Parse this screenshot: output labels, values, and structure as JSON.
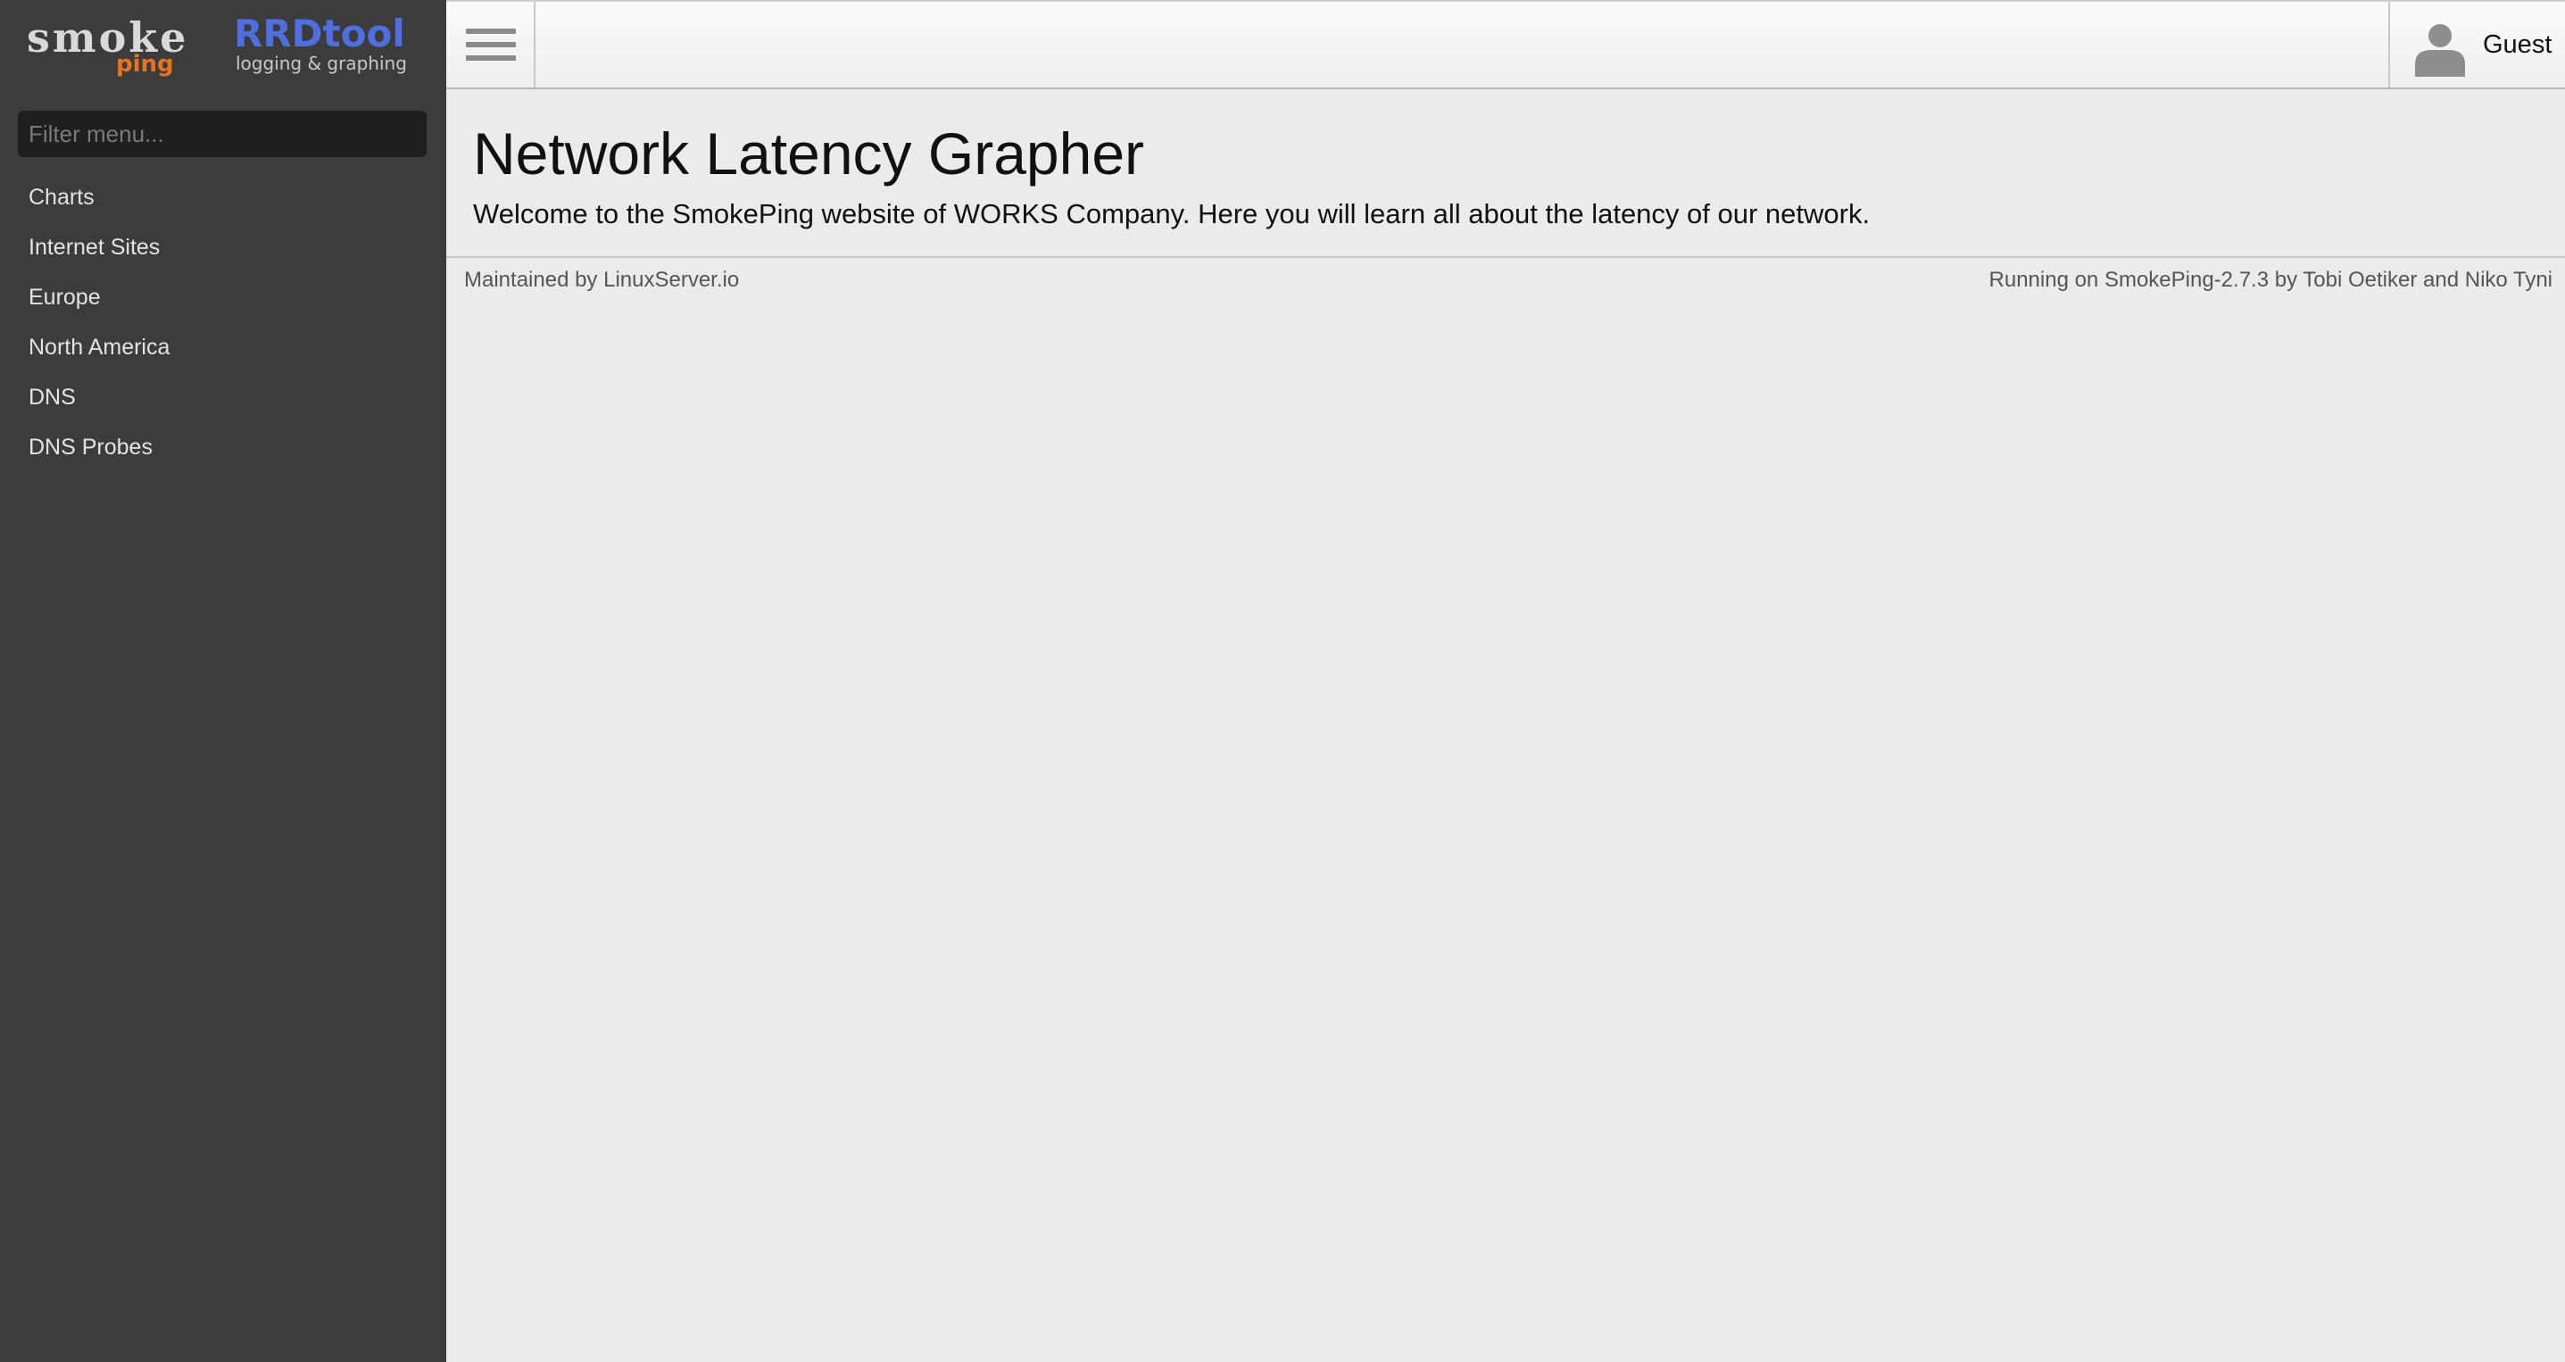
{
  "sidebar": {
    "logos": {
      "smokeping": {
        "word": "smoke",
        "sub": "ping"
      },
      "rrdtool": {
        "word": "RRDtool",
        "sub": "logging & graphing"
      }
    },
    "filter_placeholder": "Filter menu...",
    "items": [
      {
        "label": "Charts"
      },
      {
        "label": "Internet Sites"
      },
      {
        "label": "Europe"
      },
      {
        "label": "North America"
      },
      {
        "label": "DNS"
      },
      {
        "label": "DNS Probes"
      }
    ]
  },
  "header": {
    "menu_icon": "hamburger-icon",
    "user_icon": "user-icon",
    "user_name": "Guest"
  },
  "main": {
    "title": "Network Latency Grapher",
    "welcome": "Welcome to the SmokePing website of WORKS Company. Here you will learn all about the latency of our network.",
    "footer_left": "Maintained by LinuxServer.io",
    "footer_right": "Running on SmokePing-2.7.3 by Tobi Oetiker and Niko Tyni"
  },
  "colors": {
    "sidebar_bg": "#3c3c3c",
    "page_bg": "#ebebeb",
    "ping_orange": "#e8731e",
    "rrd_blue": "#4f6fe0"
  }
}
